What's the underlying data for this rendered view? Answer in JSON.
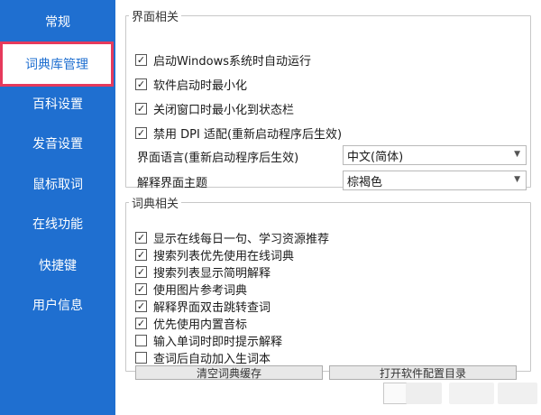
{
  "sidebar": {
    "items": [
      {
        "label": "常规"
      },
      {
        "label": "词典库管理"
      },
      {
        "label": "百科设置"
      },
      {
        "label": "发音设置"
      },
      {
        "label": "鼠标取词"
      },
      {
        "label": "在线功能"
      },
      {
        "label": "快捷键"
      },
      {
        "label": "用户信息"
      }
    ],
    "selected": "词典库管理"
  },
  "interface_group": {
    "title": "界面相关",
    "checkboxes": [
      {
        "label": "启动Windows系统时自动运行",
        "checked": "✓"
      },
      {
        "label": "软件启动时最小化",
        "checked": "✓"
      },
      {
        "label": "关闭窗口时最小化到状态栏",
        "checked": "✓"
      },
      {
        "label": "禁用 DPI 适配(重新启动程序后生效)",
        "checked": "✓"
      }
    ],
    "language": {
      "label": "界面语言(重新启动程序后生效)",
      "value": "中文(简体)"
    },
    "theme": {
      "label": "解释界面主题",
      "value": "棕褐色"
    }
  },
  "dictionary_group": {
    "title": "词典相关",
    "checkboxes": [
      {
        "label": "显示在线每日一句、学习资源推荐",
        "checked": "✓"
      },
      {
        "label": "搜索列表优先使用在线词典",
        "checked": "✓"
      },
      {
        "label": "搜索列表显示简明解释",
        "checked": "✓"
      },
      {
        "label": "使用图片参考词典",
        "checked": "✓"
      },
      {
        "label": "解释界面双击跳转查词",
        "checked": "✓"
      },
      {
        "label": "优先使用内置音标",
        "checked": "✓"
      },
      {
        "label": "输入单词时即时提示解释",
        "checked": ""
      },
      {
        "label": "查词后自动加入生词本",
        "checked": ""
      }
    ],
    "buttons": {
      "clear_cache": "清空词典缓存",
      "open_config": "打开软件配置目录"
    }
  },
  "colors": {
    "sidebar_bg": "#1f6fd0",
    "highlight_border": "#e63a5c"
  }
}
